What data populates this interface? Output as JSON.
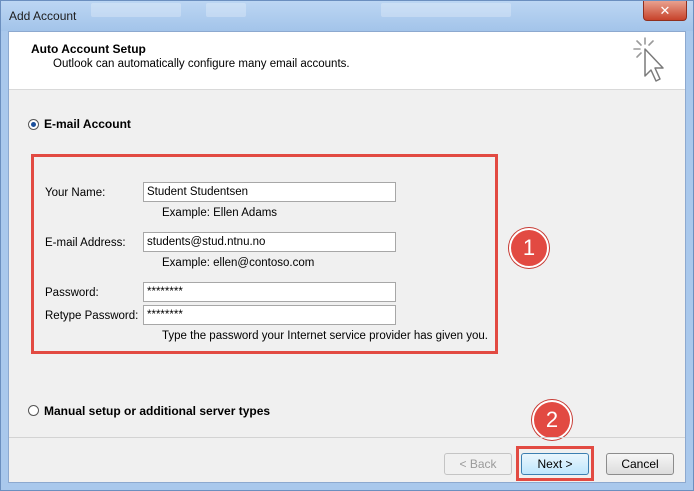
{
  "window": {
    "title": "Add Account",
    "close_label": "✕"
  },
  "header": {
    "title": "Auto Account Setup",
    "subtitle": "Outlook can automatically configure many email accounts."
  },
  "options": {
    "email_account": "E-mail Account",
    "manual_setup": "Manual setup or additional server types"
  },
  "form": {
    "name_label": "Your Name:",
    "name_value": "Student Studentsen",
    "name_hint": "Example: Ellen Adams",
    "email_label": "E-mail Address:",
    "email_value": "students@stud.ntnu.no",
    "email_hint": "Example: ellen@contoso.com",
    "password_label": "Password:",
    "password_value": "********",
    "retype_label": "Retype Password:",
    "retype_value": "********",
    "password_hint": "Type the password your Internet service provider has given you."
  },
  "annotations": {
    "step1": "1",
    "step2": "2"
  },
  "buttons": {
    "back": "< Back",
    "next": "Next >",
    "cancel": "Cancel"
  },
  "colors": {
    "annotation": "#e24a42",
    "titlebar": "#a9c8ec",
    "close": "#c7432b"
  }
}
